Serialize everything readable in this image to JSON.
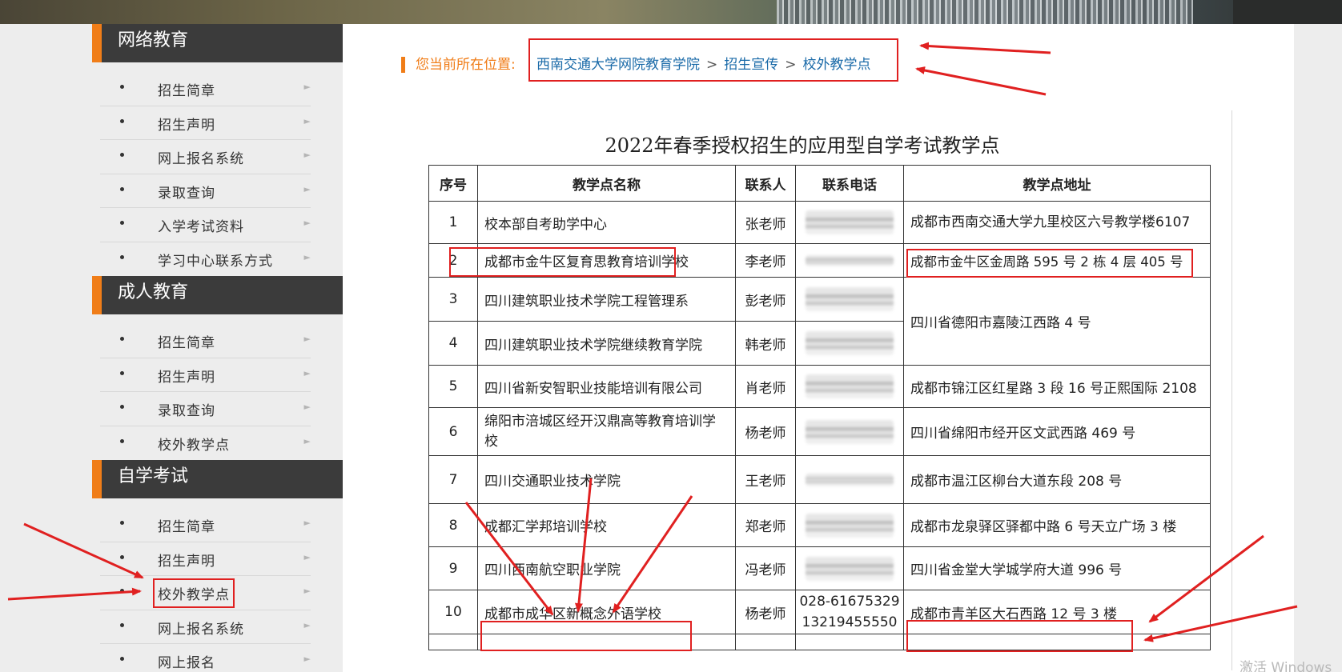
{
  "sidebar": {
    "sections": [
      {
        "title": "网络教育",
        "items": [
          "招生简章",
          "招生声明",
          "网上报名系统",
          "录取查询",
          "入学考试资料",
          "学习中心联系方式"
        ]
      },
      {
        "title": "成人教育",
        "items": [
          "招生简章",
          "招生声明",
          "录取查询",
          "校外教学点"
        ]
      },
      {
        "title": "自学考试",
        "items": [
          "招生简章",
          "招生声明",
          "校外教学点",
          "网上报名系统",
          "网上报名"
        ]
      }
    ],
    "arrow_glyph": "►"
  },
  "breadcrumb": {
    "prefix": "您当前所在位置:",
    "links": [
      "西南交通大学网院教育学院",
      "招生宣传",
      "校外教学点"
    ],
    "separator": ">"
  },
  "document": {
    "title": "2022年春季授权招生的应用型自学考试教学点",
    "headers": [
      "序号",
      "教学点名称",
      "联系人",
      "联系电话",
      "教学点地址"
    ],
    "rows": [
      {
        "no": "1",
        "name": "校本部自考助学中心",
        "contact": "张老师",
        "address": "成都市西南交通大学九里校区六号教学楼6107"
      },
      {
        "no": "2",
        "name": "成都市金牛区复育思教育培训学校",
        "contact": "李老师",
        "address": "成都市金牛区金周路 595 号 2 栋 4 层 405 号"
      },
      {
        "no": "3",
        "name": "四川建筑职业技术学院工程管理系",
        "contact": "彭老师",
        "address": "四川省德阳市嘉陵江西路 4 号"
      },
      {
        "no": "4",
        "name": "四川建筑职业技术学院继续教育学院",
        "contact": "韩老师",
        "address": ""
      },
      {
        "no": "5",
        "name": "四川省新安智职业技能培训有限公司",
        "contact": "肖老师",
        "address": "成都市锦江区红星路 3 段 16 号正熙国际 2108"
      },
      {
        "no": "6",
        "name": "绵阳市涪城区经开汉鼎高等教育培训学校",
        "contact": "杨老师",
        "address": "四川省绵阳市经开区文武西路 469 号"
      },
      {
        "no": "7",
        "name": "四川交通职业技术学院",
        "contact": "王老师",
        "address": "成都市温江区柳台大道东段 208 号"
      },
      {
        "no": "8",
        "name": "成都汇学邦培训学校",
        "contact": "郑老师",
        "address": "成都市龙泉驿区驿都中路 6 号天立广场 3 楼"
      },
      {
        "no": "9",
        "name": "四川西南航空职业学院",
        "contact": "冯老师",
        "address": "四川省金堂大学城学府大道 996 号"
      },
      {
        "no": "10",
        "name": "成都市成华区新概念外语学校",
        "contact": "杨老师",
        "address": "成都市青羊区大石西路 12 号 3 楼",
        "phone_1": "028-61675329",
        "phone_2": "13219455550"
      }
    ]
  },
  "watermark": "激活 Windows",
  "colors": {
    "accent": "#f07d18",
    "annotation": "#e02020",
    "link": "#1a6aa8",
    "section_bg": "#3b3b3b"
  }
}
